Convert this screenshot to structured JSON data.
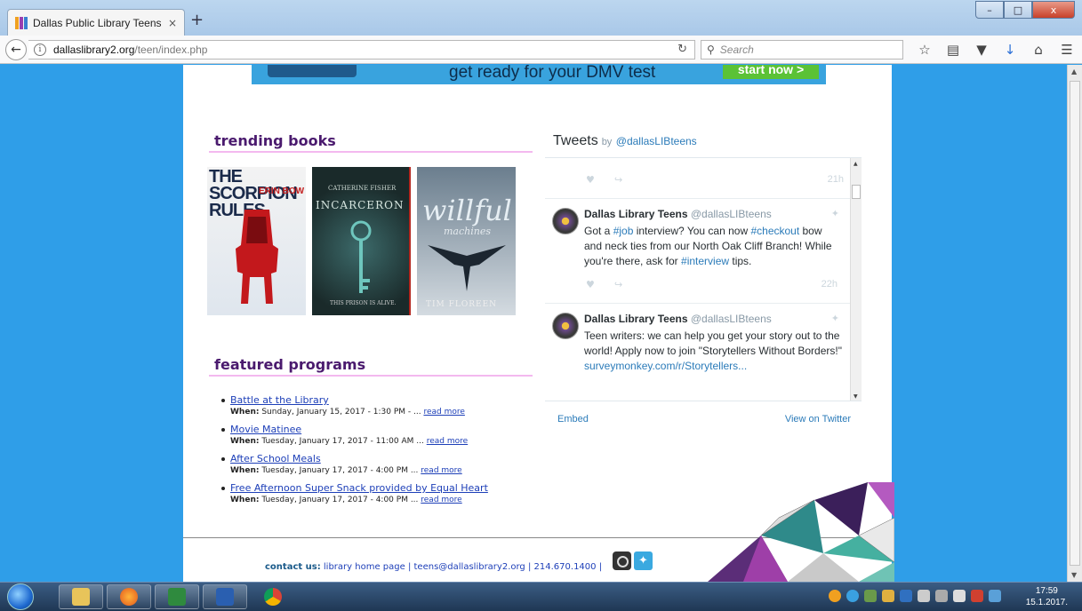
{
  "browser": {
    "tab_title": "Dallas Public Library Teens ...",
    "tab_close": "×",
    "new_tab": "+",
    "url_host": "dallaslibrary2.org",
    "url_path": "/teen/index.php",
    "search_placeholder": "Search",
    "window_buttons": {
      "minimize": "–",
      "maximize": "□",
      "close": "x"
    },
    "icons": [
      "star-icon",
      "reading-list-icon",
      "pocket-icon",
      "download-icon",
      "home-icon",
      "menu-icon"
    ]
  },
  "ad": {
    "text": "get ready for your DMV test",
    "button": "start now >"
  },
  "trending": {
    "title": "trending books",
    "books": [
      {
        "title": "THE SCORPION RULES",
        "author": "ERIN BOW"
      },
      {
        "title": "INCARCERON",
        "author": "CATHERINE FISHER",
        "tagline": "THIS PRISON IS ALIVE."
      },
      {
        "title": "willful",
        "subtitle": "machines",
        "author": "TIM FLOREEN"
      }
    ]
  },
  "featured": {
    "title": "featured programs",
    "when_label": "When:",
    "read_more": "read more",
    "items": [
      {
        "name": "Battle at the Library",
        "when": "Sunday, January 15, 2017 - 1:30 PM - ... "
      },
      {
        "name": "Movie Matinee",
        "when": "Tuesday, January 17, 2017 - 11:00 AM ... "
      },
      {
        "name": "After School Meals",
        "when": "Tuesday, January 17, 2017 - 4:00 PM ... "
      },
      {
        "name": "Free Afternoon Super Snack provided by Equal Heart",
        "when": "Tuesday, January 17, 2017 - 4:00 PM ... "
      }
    ]
  },
  "twitter": {
    "header": "Tweets",
    "by": "by",
    "handle": "@dallasLIBteens",
    "top_time": "21h",
    "tweets": [
      {
        "name": "Dallas Library Teens",
        "at": "@dallasLIBteens",
        "time": "22h",
        "text_parts": [
          "Got a ",
          "#job",
          " interview? You can now ",
          "#checkout",
          " bow and neck ties from our North Oak Cliff Branch! While you're there, ask for ",
          "#interview",
          " tips."
        ]
      },
      {
        "name": "Dallas Library Teens",
        "at": "@dallasLIBteens",
        "text_parts": [
          "Teen writers: we can help you get your story out to the world! Apply now to join \"Storytellers Without Borders!\"",
          "surveymonkey.com/r/Storytellers..."
        ]
      }
    ],
    "embed": "Embed",
    "view_on_twitter": "View on Twitter"
  },
  "footer": {
    "contact_label": "contact us:",
    "home_link": "library home page",
    "email": "teens@dallaslibrary2.org",
    "phone": "214.670.1400",
    "sep": "|"
  },
  "taskbar": {
    "clock_time": "17:59",
    "clock_date": "15.1.2017."
  }
}
